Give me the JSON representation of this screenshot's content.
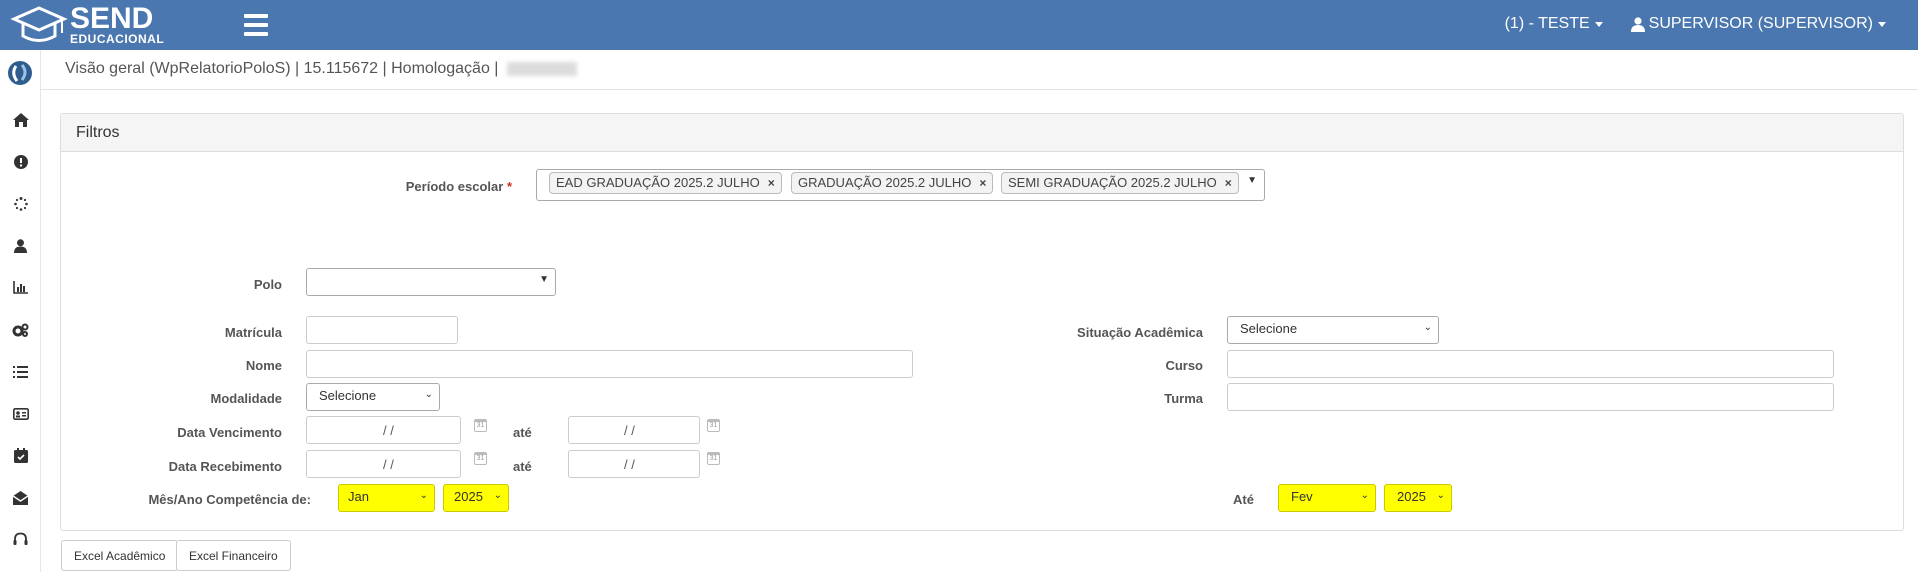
{
  "header": {
    "logo_top": "SEND",
    "logo_bottom": "EDUCACIONAL",
    "unit_menu": "(1) - TESTE",
    "user_menu": "SUPERVISOR (SUPERVISOR)",
    "bg_color": "#4a77b0"
  },
  "sidebar": {
    "icons": [
      "app-logo-icon",
      "home-icon",
      "alert-icon",
      "spinner-icon",
      "user-icon",
      "bar-chart-icon",
      "gears-icon",
      "list-icon",
      "id-card-icon",
      "calendar-check-icon",
      "envelope-open-icon",
      "headset-icon"
    ]
  },
  "breadcrumb": {
    "text": "Visão geral (WpRelatorioPoloS) | 15.115672 | Homologação |"
  },
  "panel": {
    "title": "Filtros"
  },
  "form": {
    "periodo_label": "Período escolar",
    "required_mark": "*",
    "periodo_tags": [
      "EAD GRADUAÇÃO 2025.2 JULHO",
      "GRADUAÇÃO 2025.2 JULHO",
      "SEMI GRADUAÇÃO 2025.2 JULHO"
    ],
    "polo_label": "Polo",
    "polo_value": "",
    "matricula_label": "Matrícula",
    "matricula_value": "",
    "nome_label": "Nome",
    "nome_value": "",
    "modalidade_label": "Modalidade",
    "modalidade_value": "Selecione",
    "venc_label": "Data Vencimento",
    "receb_label": "Data Recebimento",
    "ate_label": "até",
    "date_placeholder": "/ /",
    "comp_label": "Mês/Ano Competência de:",
    "comp_from_month": "Jan",
    "comp_from_year": "2025",
    "situacao_label": "Situação Acadêmica",
    "situacao_value": "Selecione",
    "curso_label": "Curso",
    "curso_value": "",
    "turma_label": "Turma",
    "turma_value": "",
    "comp_to_label": "Até",
    "comp_to_month": "Fev",
    "comp_to_year": "2025",
    "highlight_color": "#ffff00"
  },
  "buttons": {
    "excel_academico": "Excel Acadêmico",
    "excel_financeiro": "Excel Financeiro"
  }
}
